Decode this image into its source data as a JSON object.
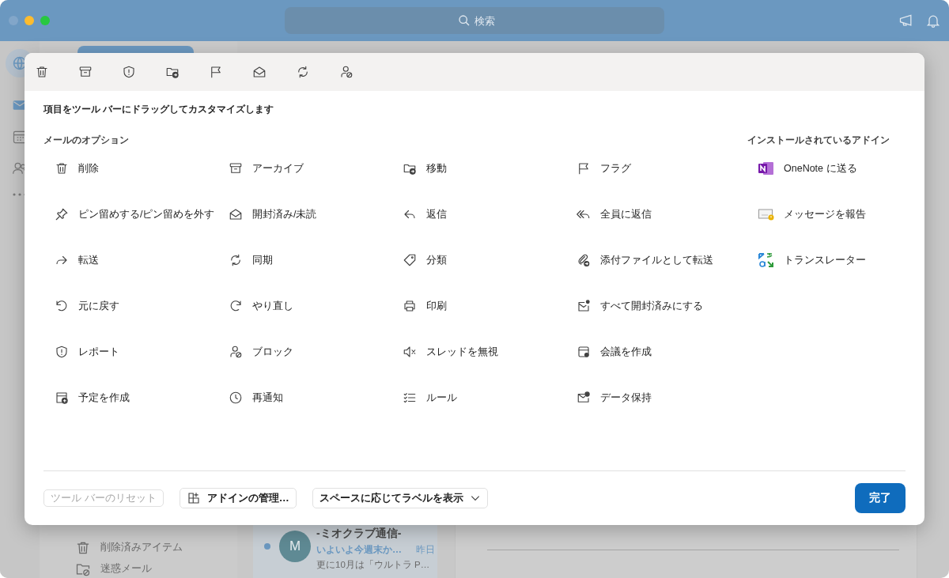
{
  "window": {
    "search": {
      "placeholder": "検索"
    }
  },
  "folders": [
    {
      "label": "削除済みアイテム"
    },
    {
      "label": "迷惑メール"
    }
  ],
  "messages": [
    {
      "sender": "-ミオクラブ通信-",
      "avatar": "M",
      "subject": "いよいよ今週末か…",
      "time": "昨日",
      "preview": "更に10月は「ウルトラ P…",
      "unread": true
    }
  ],
  "dialog": {
    "hint": "項目をツール バーにドラッグしてカスタマイズします",
    "mail_options": {
      "title": "メールのオプション",
      "items": [
        "削除",
        "アーカイブ",
        "移動",
        "フラグ",
        "ピン留めする/ピン留めを外す",
        "開封済み/未読",
        "返信",
        "全員に返信",
        "転送",
        "同期",
        "分類",
        "添付ファイルとして転送",
        "元に戻す",
        "やり直し",
        "印刷",
        "すべて開封済みにする",
        "レポート",
        "ブロック",
        "スレッドを無視",
        "会議を作成",
        "予定を作成",
        "再通知",
        "ルール",
        "データ保持"
      ]
    },
    "addins": {
      "title": "インストールされているアドイン",
      "items": [
        "OneNote に送る",
        "メッセージを報告",
        "トランスレーター"
      ]
    },
    "footer": {
      "reset": {
        "label": "ツール バーのリセット",
        "disabled": true
      },
      "manage_addins": "アドインの管理…",
      "labels_dropdown": {
        "value": "スペースに応じてラベルを表示"
      },
      "done": "完了"
    }
  }
}
